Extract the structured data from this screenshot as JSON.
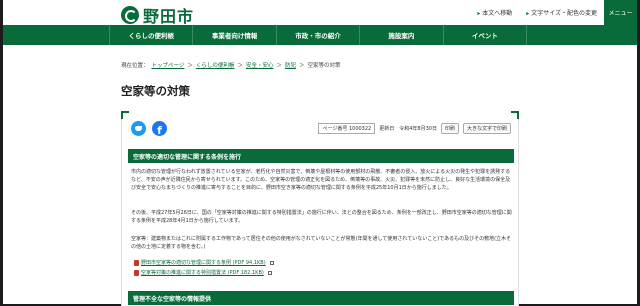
{
  "header": {
    "logo_text": "野田市",
    "links": [
      "本文へ移動",
      "文字サイズ・配色の変更"
    ],
    "menu_label": "メニュー"
  },
  "nav": {
    "items": [
      "くらしの便利帳",
      "事業者向け情報",
      "市政・市の紹介",
      "施設案内",
      "イベント"
    ]
  },
  "breadcrumb": {
    "prefix": "現在位置：",
    "items": [
      "トップページ",
      "くらしの便利帳",
      "安全・安心",
      "防犯"
    ],
    "current": "空家等の対策"
  },
  "page": {
    "title": "空家等の対策",
    "page_id_label": "ページ番号 1000322",
    "updated": "更新日　令和4年8月30日",
    "print_label": "印刷",
    "large_print_label": "大きな文字で印刷"
  },
  "section1": {
    "heading": "空家等の適切な管理に関する条例を施行",
    "para1": "市内の適切な管理が行なわれず放置されている空家が、老朽化や自然災害で、倒壊や屋根材等の使用部材の飛散、不審者の侵入、放火による火災の発生や犯罪を誘発するなど、不安の声が近隣住民から寄せられています。このため、空家等の管理の適正化を図るため、倒壊等の事故、火災、犯罪等を未然に防止し、良好な生活環境の保全及び安全で安心なまちづくりの推進に寄与することを目的に、野田市空き家等の適切な管理に関する条例を平成25年10月1日から施行しました。",
    "para2": "その後、平成27年5月26日に、国の「空家等対策の推進に関する特別措置法」の施行に伴い、法との整合を図るため、条例を一部改正し、野田市空家等の適切な管理に関する条例を平成28年4月1日から施行しています。",
    "para3": "空家等：建築物またはこれに附属する工作物であって居住その他の使用がなされていないことが常態(年間を通して使用されていないこと)であるもの及びその敷地(立木その他の土地に定着する物を含む。)",
    "links": [
      "野田市空家等の適切な管理に関する条例 (PDF 94.1KB)",
      "空家等対策の推進に関する特別措置法 (PDF 182.1KB)"
    ]
  },
  "section2": {
    "heading": "管理不全な空家等の情報提供"
  },
  "colors": {
    "brand": "#0a6b3a"
  }
}
